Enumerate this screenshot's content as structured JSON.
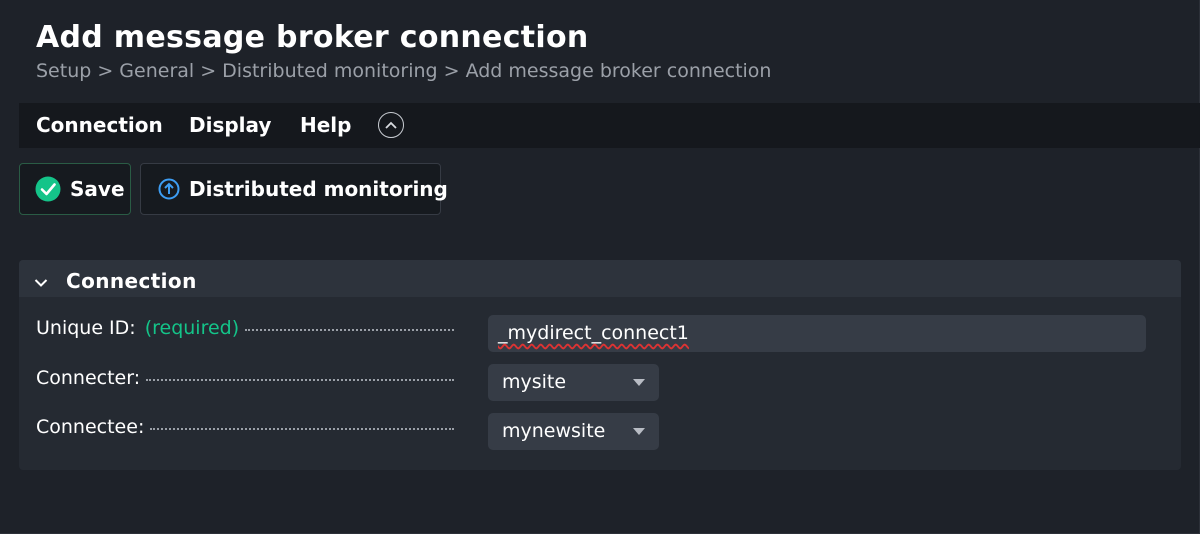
{
  "page": {
    "title": "Add message broker connection",
    "breadcrumb": "Setup > General > Distributed monitoring > Add message broker connection"
  },
  "menu": {
    "items": [
      {
        "label": "Connection"
      },
      {
        "label": "Display"
      },
      {
        "label": "Help"
      }
    ],
    "collapse_icon": "chevron-up-circle-icon"
  },
  "toolbar": {
    "save_label": "Save",
    "save_icon": "check-circle-icon",
    "distributed_label": "Distributed monitoring",
    "distributed_icon": "arrow-up-circle-icon"
  },
  "section": {
    "title": "Connection",
    "toggle_icon": "chevron-down-icon"
  },
  "form": {
    "unique_id": {
      "label": "Unique ID:",
      "required_note": "(required)",
      "value": "_mydirect_connect1"
    },
    "connecter": {
      "label": "Connecter:",
      "value": "mysite"
    },
    "connectee": {
      "label": "Connectee:",
      "value": "mynewsite"
    }
  },
  "colors": {
    "background": "#1e2229",
    "accent_green": "#14c489",
    "accent_blue": "#3d9df3"
  }
}
